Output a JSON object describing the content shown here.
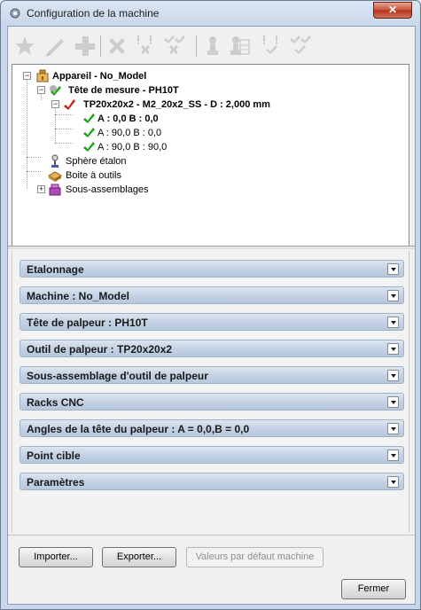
{
  "window": {
    "title": "Configuration de la machine",
    "close_label": "✕"
  },
  "toolbar": {
    "buttons": [
      {
        "name": "favorite-star-icon"
      },
      {
        "name": "edit-pencil-icon"
      },
      {
        "name": "add-plus-icon"
      },
      {
        "name": "delete-x-icon"
      },
      {
        "name": "warning-delete-icon"
      },
      {
        "name": "check-delete-icon"
      },
      {
        "name": "probe-icon"
      },
      {
        "name": "probe-grid-icon"
      },
      {
        "name": "warning-toggle-icon"
      },
      {
        "name": "check-toggle-icon"
      }
    ]
  },
  "tree": {
    "device_label": "Appareil - No_Model",
    "head_label": "Tête de mesure - PH10T",
    "probe_label": "TP20x20x2 - M2_20x2_SS - D : 2,000 mm",
    "angle1_label": "A : 0,0 B : 0,0",
    "angle2_label": "A : 90,0 B : 0,0",
    "angle3_label": "A : 90,0 B : 90,0",
    "sphere_label": "Sphère étalon",
    "toolbox_label": "Boite à outils",
    "subassembly_label": "Sous-assemblages"
  },
  "sections": [
    "Etalonnage",
    "Machine : No_Model",
    "Tête de palpeur : PH10T",
    "Outil de palpeur : TP20x20x2",
    "Sous-assemblage d'outil de palpeur",
    "Racks CNC",
    "Angles de la tête du palpeur : A = 0,0,B = 0,0",
    "Point cible",
    "Paramètres"
  ],
  "buttons": {
    "import": "Importer...",
    "export": "Exporter...",
    "defaults": "Valeurs par défaut machine",
    "close": "Fermer"
  },
  "colors": {
    "section_bg": "#c4d2e4",
    "title_bg": "#c7d6ea",
    "check_green": "#22a022",
    "check_red": "#d02020"
  }
}
